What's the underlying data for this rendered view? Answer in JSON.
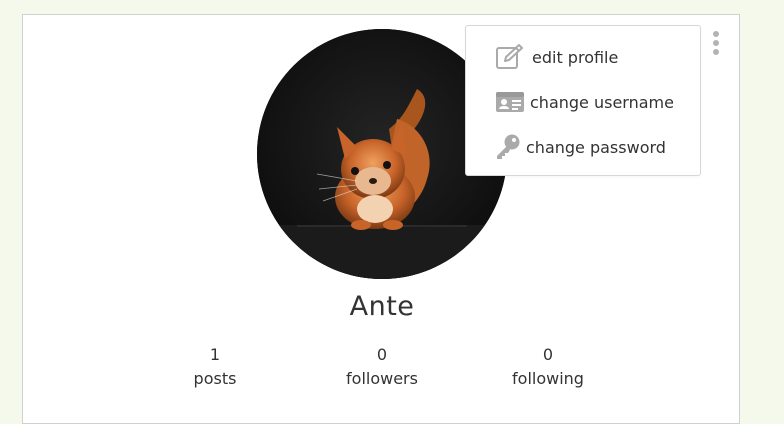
{
  "profile": {
    "username": "Ante",
    "avatar_icon": "squirrel-photo",
    "stats": {
      "posts": {
        "value": "1",
        "label": "posts"
      },
      "followers": {
        "value": "0",
        "label": "followers"
      },
      "following": {
        "value": "0",
        "label": "following"
      }
    }
  },
  "menu": {
    "trigger_icon": "more-vertical-icon",
    "items": [
      {
        "label": "edit profile",
        "icon": "edit-icon"
      },
      {
        "label": "change username",
        "icon": "id-card-icon"
      },
      {
        "label": "change password",
        "icon": "key-icon"
      }
    ]
  },
  "colors": {
    "page_background": "#f5f9ec",
    "card_background": "#ffffff",
    "text": "#333333",
    "icon": "#aaaaaa"
  }
}
